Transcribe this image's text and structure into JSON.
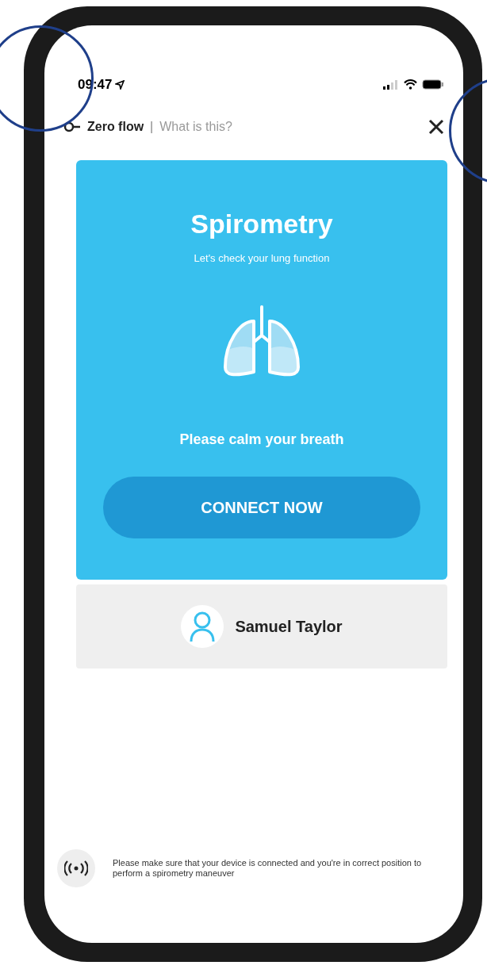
{
  "status_bar": {
    "time": "09:47"
  },
  "header": {
    "title": "Zero flow",
    "separator": "|",
    "link": "What is this?"
  },
  "card": {
    "title": "Spirometry",
    "subtitle": "Let's check your lung function",
    "instruction": "Please calm your breath",
    "button": "CONNECT NOW"
  },
  "patient": {
    "name": "Samuel Taylor"
  },
  "footer": {
    "note": "Please make sure that your device is connected and you're in correct position to perform a spirometry maneuver"
  }
}
